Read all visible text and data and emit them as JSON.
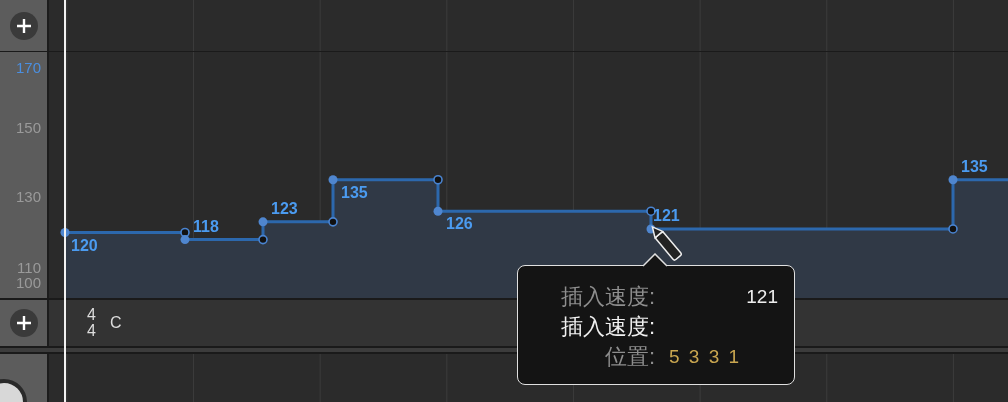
{
  "tempo_axis": [
    {
      "label": "170",
      "highlighted": true
    },
    {
      "label": "150",
      "highlighted": false
    },
    {
      "label": "130",
      "highlighted": false
    },
    {
      "label": "110",
      "highlighted": false
    },
    {
      "label": "100",
      "highlighted": false
    }
  ],
  "tempo_points": [
    {
      "value": "120"
    },
    {
      "value": "118"
    },
    {
      "value": "123"
    },
    {
      "value": "135"
    },
    {
      "value": "126"
    },
    {
      "value": "121"
    },
    {
      "value": "135"
    }
  ],
  "signature": {
    "numerator": "4",
    "denominator": "4",
    "key": "C"
  },
  "tooltip": {
    "rows": [
      {
        "kind": "tempo",
        "label": "插入速度:",
        "value": "121"
      },
      {
        "kind": "mode",
        "label": "插入速度:"
      },
      {
        "kind": "position",
        "label": "位置:",
        "value": "5 3 3 1"
      }
    ]
  }
}
